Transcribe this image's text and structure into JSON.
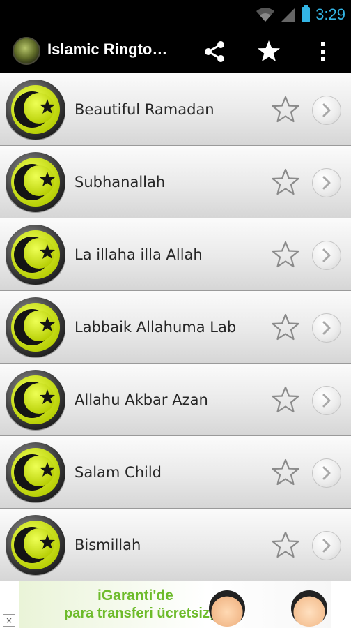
{
  "status": {
    "time": "3:29"
  },
  "appbar": {
    "title": "Islamic Ringto…"
  },
  "items": [
    {
      "title": "Beautiful Ramadan"
    },
    {
      "title": "Subhanallah"
    },
    {
      "title": "La illaha illa Allah"
    },
    {
      "title": "Labbaik Allahuma Lab"
    },
    {
      "title": "Allahu Akbar Azan"
    },
    {
      "title": "Salam Child"
    },
    {
      "title": "Bismillah"
    }
  ],
  "ad": {
    "line1": "iGaranti'de",
    "line2": "para transferi ücretsiz,",
    "close": "×"
  },
  "colors": {
    "accent": "#33b5e5",
    "icon_green": "#d6f000",
    "ad_green": "#6dbb2a"
  }
}
